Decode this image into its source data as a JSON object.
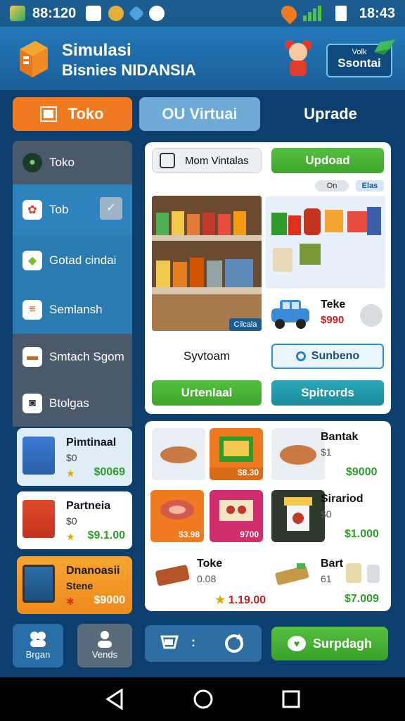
{
  "status_bar": {
    "time": "88:120",
    "clock": "18:43"
  },
  "header": {
    "title_line1": "Simulasi",
    "title_line2": "Bisnies NIDANSIA",
    "button_small": "Volk",
    "button_label": "Ssontai"
  },
  "tabs": [
    {
      "label": "Toko"
    },
    {
      "label": "OU  Virtuai"
    },
    {
      "label": "Uprade"
    }
  ],
  "sidebar": {
    "items": [
      {
        "label": "Toko"
      },
      {
        "label": "Tob"
      },
      {
        "label": "Gotad cindai"
      },
      {
        "label": "Semlansh"
      },
      {
        "label": "Smtach Sgom"
      },
      {
        "label": "Btolgas"
      }
    ],
    "cards": [
      {
        "title": "Pimtinaal",
        "sub": "$0",
        "price": "$0069"
      },
      {
        "title": "Partneia",
        "sub": "$0",
        "price": "$9.1.00"
      },
      {
        "title": "Dnanoasii",
        "sub": "Stene",
        "price": "$9000"
      }
    ],
    "bottom_buttons": [
      {
        "label": "Brgan"
      },
      {
        "label": "Vends"
      }
    ]
  },
  "main": {
    "search_label": "Mom Vintalas",
    "update_button": "Updoad",
    "toggle_left": "On",
    "toggle_right": "Elas",
    "shelf_badge": "Cilcala",
    "car_title": "Teke",
    "car_price": "$990",
    "label_sy": "Syvtoam",
    "subscribe_button": "Sunbeno",
    "btn_green": "Urtenlaal",
    "btn_teal": "Spitrords"
  },
  "grid": {
    "tiles": [
      {
        "price": ""
      },
      {
        "price": "$8.30"
      },
      {
        "price": ""
      },
      {
        "price": "$3.98"
      },
      {
        "price": "9700"
      },
      {
        "price": ""
      }
    ],
    "rows": [
      {
        "title": "Bantak",
        "sub": "$1",
        "price": "$9000"
      },
      {
        "title": "Sirariod",
        "sub": "$0",
        "price": "$1.000"
      },
      {
        "title": "Bart",
        "sub": "61",
        "price": "$7.009"
      }
    ],
    "bottom_left": {
      "title": "Toke",
      "sub": "0.08",
      "price": "1.19.00"
    }
  },
  "bottom_bar": {
    "middle_label": ":",
    "subscribe_label": "Surpdagh"
  },
  "colors": {
    "accent_orange": "#f07a1f",
    "accent_green": "#3ea52c",
    "accent_teal": "#1a8b9a",
    "header_blue": "#2378b8"
  }
}
